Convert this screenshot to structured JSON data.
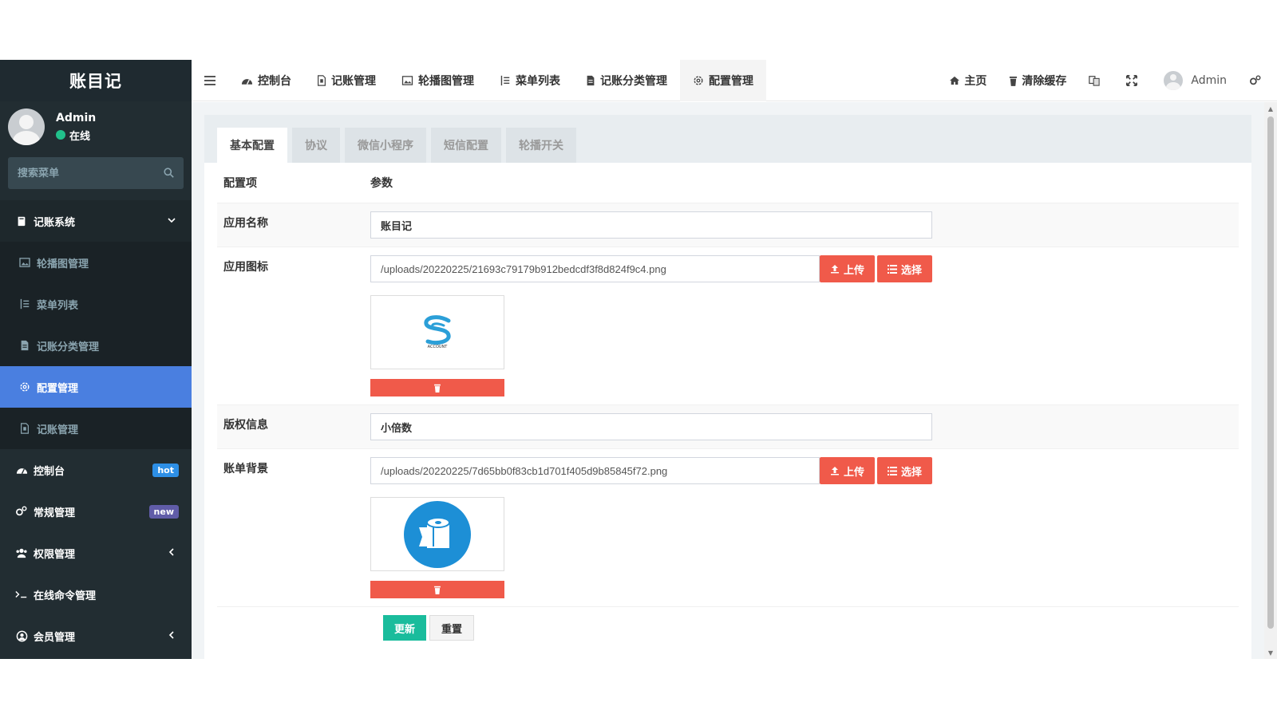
{
  "app": {
    "title": "账目记"
  },
  "user": {
    "name": "Admin",
    "status": "在线"
  },
  "sidebar": {
    "search_placeholder": "搜索菜单",
    "group": {
      "label": "记账系统"
    },
    "subitems": [
      {
        "label": "轮播图管理",
        "icon": "image-icon"
      },
      {
        "label": "菜单列表",
        "icon": "list-ordered-icon"
      },
      {
        "label": "记账分类管理",
        "icon": "file-icon"
      },
      {
        "label": "配置管理",
        "icon": "gear-icon"
      },
      {
        "label": "记账管理",
        "icon": "file-outline-icon"
      }
    ],
    "items": [
      {
        "label": "控制台",
        "badge": "hot"
      },
      {
        "label": "常规管理",
        "badge": "new"
      },
      {
        "label": "权限管理"
      },
      {
        "label": "在线命令管理"
      },
      {
        "label": "会员管理"
      }
    ]
  },
  "topnav": {
    "tabs": [
      {
        "label": "控制台"
      },
      {
        "label": "记账管理"
      },
      {
        "label": "轮播图管理"
      },
      {
        "label": "菜单列表"
      },
      {
        "label": "记账分类管理"
      },
      {
        "label": "配置管理"
      }
    ],
    "home": "主页",
    "clear_cache": "清除缓存",
    "admin": "Admin"
  },
  "config": {
    "tabs": [
      "基本配置",
      "协议",
      "微信小程序",
      "短信配置",
      "轮播开关"
    ],
    "header": {
      "item": "配置项",
      "param": "参数"
    },
    "app_name": {
      "label": "应用名称",
      "value": "账目记"
    },
    "app_icon": {
      "label": "应用图标",
      "value": "/uploads/20220225/21693c79179b912bedcdf3f8d824f9c4.png",
      "logo_text": "ACCOUNT"
    },
    "copyright": {
      "label": "版权信息",
      "value": "小倍数"
    },
    "bill_bg": {
      "label": "账单背景",
      "value": "/uploads/20220225/7d65bb0f83cb1d701f405d9b85845f72.png"
    },
    "upload_label": "上传",
    "select_label": "选择",
    "update_label": "更新",
    "reset_label": "重置"
  },
  "colors": {
    "sidebar": "#222d32",
    "active": "#4a7fe0",
    "danger": "#f05a4a",
    "success": "#1abc9c"
  }
}
